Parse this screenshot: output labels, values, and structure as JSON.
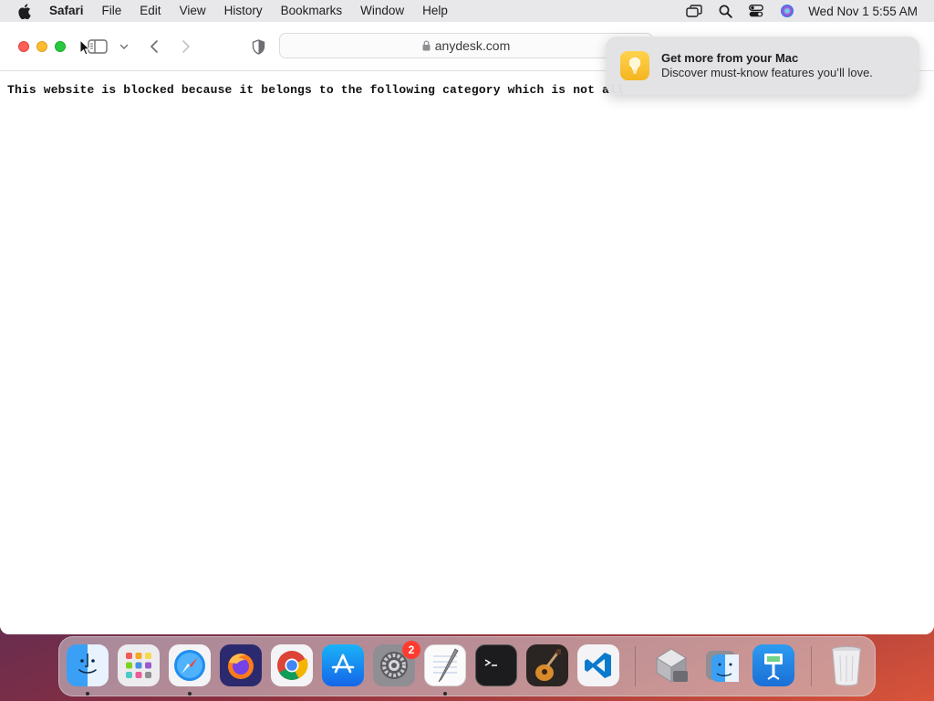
{
  "menubar": {
    "app_name": "Safari",
    "items": [
      "File",
      "Edit",
      "View",
      "History",
      "Bookmarks",
      "Window",
      "Help"
    ],
    "clock": "Wed Nov 1  5:55 AM",
    "status_icons": [
      "screen-mirroring-icon",
      "spotlight-search-icon",
      "control-center-icon",
      "siri-icon"
    ]
  },
  "toolbar": {
    "url": "anydesk.com"
  },
  "page": {
    "blocked_message": "This website is blocked because it belongs to the following category which is not all"
  },
  "notification": {
    "title": "Get more from your Mac",
    "body": "Discover must-know features you’ll love.",
    "icon": "tips-lightbulb-icon"
  },
  "dock": {
    "apps": [
      {
        "name": "Finder",
        "running": true
      },
      {
        "name": "Launchpad",
        "running": false
      },
      {
        "name": "Safari",
        "running": true
      },
      {
        "name": "Firefox",
        "running": false
      },
      {
        "name": "Google Chrome",
        "running": false
      },
      {
        "name": "App Store",
        "running": false
      },
      {
        "name": "System Preferences",
        "running": false,
        "badge": "2"
      },
      {
        "name": "TextEdit",
        "running": true
      },
      {
        "name": "Terminal",
        "running": false
      },
      {
        "name": "GarageBand",
        "running": false
      },
      {
        "name": "Visual Studio Code",
        "running": false
      },
      {
        "name": "Migration Assistant",
        "running": false
      },
      {
        "name": "Finder Folder",
        "running": false
      },
      {
        "name": "Keynote",
        "running": false
      },
      {
        "name": "Trash",
        "running": false
      }
    ]
  },
  "colors": {
    "close": "#fe5f57",
    "minimize": "#febc2e",
    "maximize": "#28c840",
    "badge": "#ff3b30"
  }
}
